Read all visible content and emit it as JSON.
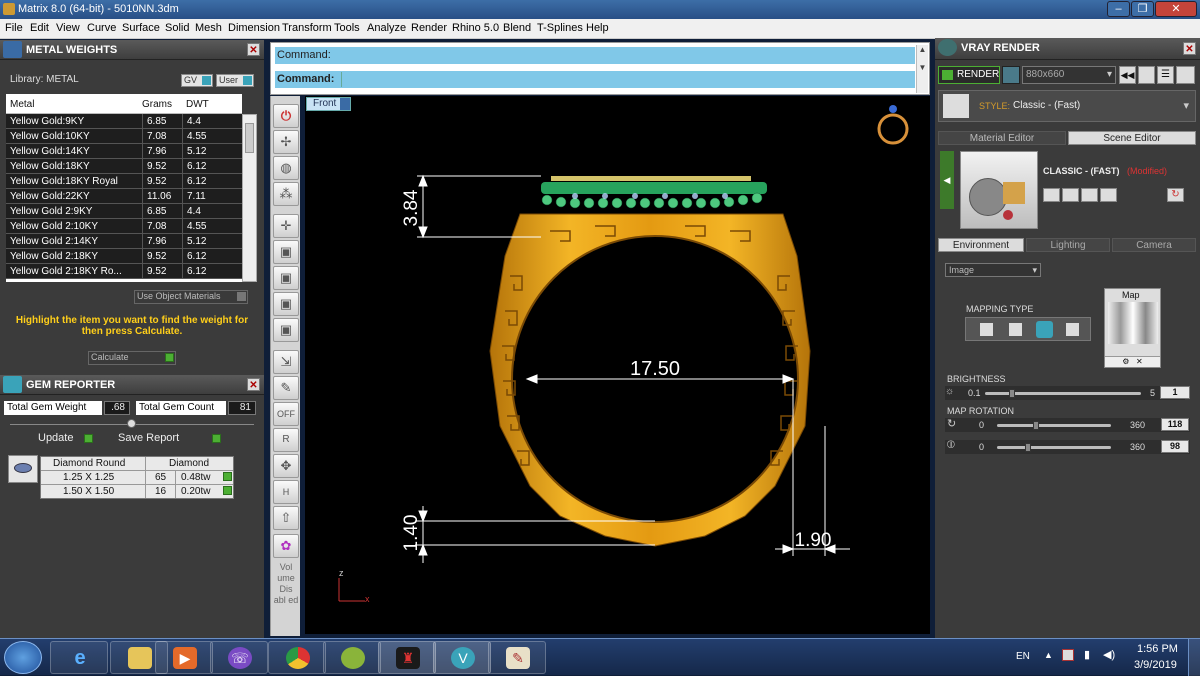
{
  "window": {
    "title": "Matrix 8.0 (64-bit) - 5010NN.3dm"
  },
  "menu": [
    "File",
    "Edit",
    "View",
    "Curve",
    "Surface",
    "Solid",
    "Mesh",
    "Dimension",
    "Transform",
    "Tools",
    "Analyze",
    "Render",
    "Rhino 5.0",
    "Blend",
    "T-Splines",
    "Help"
  ],
  "metal_weights": {
    "title": "METAL WEIGHTS",
    "library_label": "Library: METAL",
    "gv_label": "GV",
    "user_label": "User",
    "columns": [
      "Metal",
      "Grams",
      "DWT"
    ],
    "rows": [
      [
        "Yellow Gold:9KY",
        "6.85",
        "4.4"
      ],
      [
        "Yellow Gold:10KY",
        "7.08",
        "4.55"
      ],
      [
        "Yellow Gold:14KY",
        "7.96",
        "5.12"
      ],
      [
        "Yellow Gold:18KY",
        "9.52",
        "6.12"
      ],
      [
        "Yellow Gold:18KY Royal",
        "9.52",
        "6.12"
      ],
      [
        "Yellow Gold:22KY",
        "11.06",
        "7.11"
      ],
      [
        "Yellow Gold 2:9KY",
        "6.85",
        "4.4"
      ],
      [
        "Yellow Gold 2:10KY",
        "7.08",
        "4.55"
      ],
      [
        "Yellow Gold 2:14KY",
        "7.96",
        "5.12"
      ],
      [
        "Yellow Gold 2:18KY",
        "9.52",
        "6.12"
      ],
      [
        "Yellow Gold 2:18KY Ro...",
        "9.52",
        "6.12"
      ]
    ],
    "use_object_materials": "Use Object Materials",
    "hint": "Highlight the item you want to find the weight for then press Calculate.",
    "calculate_label": "Calculate"
  },
  "gem_reporter": {
    "title": "GEM REPORTER",
    "total_weight_label": "Total Gem Weight",
    "total_weight_value": ".68",
    "total_count_label": "Total Gem Count",
    "total_count_value": "81",
    "update_label": "Update",
    "save_report_label": "Save Report",
    "table_header": [
      "Diamond Round",
      "Diamond"
    ],
    "rows": [
      [
        "1.25 X 1.25",
        "65",
        "0.48tw"
      ],
      [
        "1.50 X 1.50",
        "16",
        "0.20tw"
      ]
    ]
  },
  "command": {
    "line1_label": "Command:",
    "line2_label": "Command:"
  },
  "viewport": {
    "name": "Front",
    "dimensions": {
      "top_height": "3.84",
      "inner_diameter": "17.50",
      "bottom_height": "1.40",
      "bottom_width": "1.90"
    },
    "axis_z": "z",
    "axis_x": "x"
  },
  "toolbar_side_text": "Vol ume Dis abl ed",
  "vray": {
    "title": "VRAY RENDER",
    "render_label": "RENDER",
    "resolution": "880x660",
    "style_label": "STYLE:",
    "style_value": "Classic - (Fast)",
    "tabs": [
      "Material Editor",
      "Scene Editor"
    ],
    "preset_name": "CLASSIC - (FAST)",
    "preset_modified": "(Modified)",
    "env_tabs": [
      "Environment",
      "Lighting",
      "Camera"
    ],
    "env_type": "Image",
    "mapping_type_label": "MAPPING TYPE",
    "map_label": "Map",
    "brightness_label": "BRIGHTNESS",
    "brightness_min": "0.1",
    "brightness_max": "5",
    "brightness_value": "1",
    "map_rotation_label": "MAP ROTATION",
    "rot1_min": "0",
    "rot1_max": "360",
    "rot1_value": "118",
    "rot2_min": "0",
    "rot2_max": "360",
    "rot2_value": "98"
  },
  "taskbar": {
    "lang": "EN",
    "time": "1:56 PM",
    "date": "3/9/2019"
  },
  "colors": {
    "gold": "#e8a21c",
    "gold_dark": "#b5740a",
    "command_bg": "#80c8e8",
    "hint": "#ffcf1a",
    "green": "#4caf33"
  }
}
